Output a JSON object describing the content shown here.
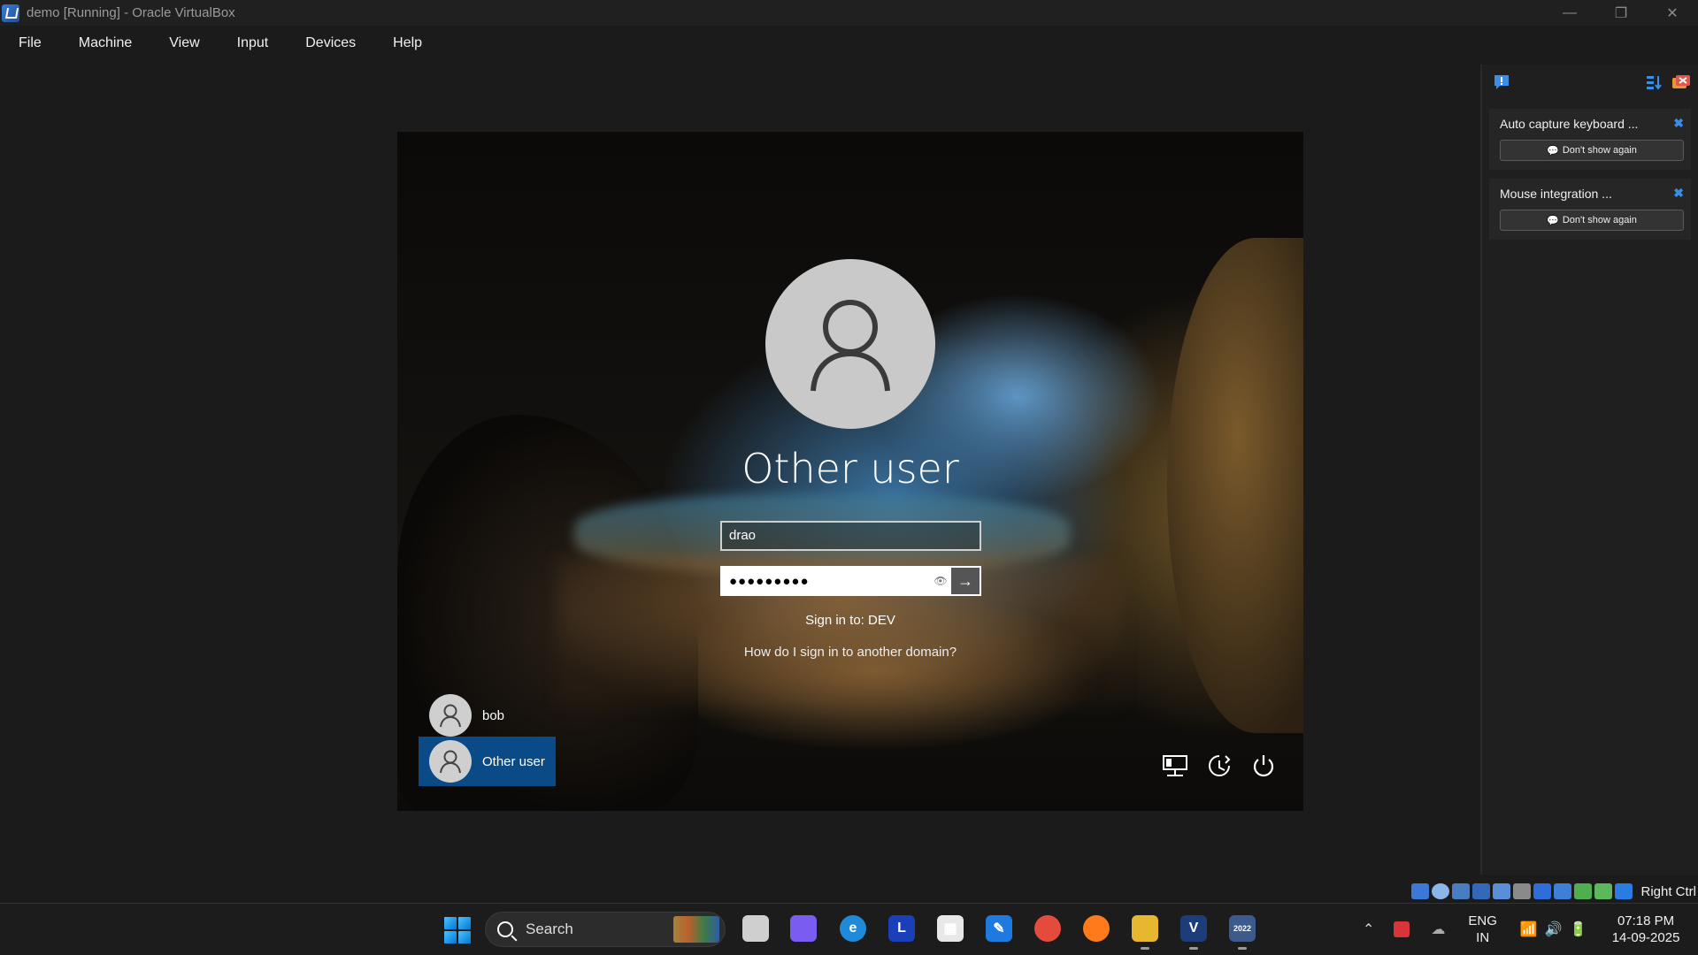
{
  "window": {
    "title": "demo [Running] - Oracle VirtualBox",
    "controls": {
      "minimize": "—",
      "restore": "❐",
      "close": "✕"
    }
  },
  "menu": [
    "File",
    "Machine",
    "View",
    "Input",
    "Devices",
    "Help"
  ],
  "login": {
    "user_title": "Other user",
    "username_value": "drao",
    "password_value": "●●●●●●●●●",
    "eye_glyph": "👁",
    "submit_glyph": "→",
    "sign_in_to": "Sign in to: DEV",
    "other_domain_link": "How do I sign in to another domain?",
    "users": [
      {
        "label": "bob",
        "selected": false
      },
      {
        "label": "Other user",
        "selected": true
      }
    ]
  },
  "notifications": [
    {
      "message": "Auto capture keyboard ...",
      "dont_show": "Don't show again"
    },
    {
      "message": "Mouse integration ...",
      "dont_show": "Don't show again"
    }
  ],
  "vbox_status": {
    "host_key": "Right Ctrl"
  },
  "taskbar": {
    "search_placeholder": "Search",
    "apps": [
      {
        "name": "task-view",
        "glyph": "",
        "color": "#cfcfcf"
      },
      {
        "name": "copilot",
        "glyph": "",
        "color": "#7b5cf0"
      },
      {
        "name": "edge",
        "glyph": "e",
        "color": "#1f8ad8"
      },
      {
        "name": "l-app",
        "glyph": "L",
        "color": "#1a3fb8"
      },
      {
        "name": "store",
        "glyph": "▦",
        "color": "#e8e8e8"
      },
      {
        "name": "pen-app",
        "glyph": "✎",
        "color": "#1f7adf"
      },
      {
        "name": "chrome",
        "glyph": "",
        "color": "#e54b3c"
      },
      {
        "name": "firefox",
        "glyph": "",
        "color": "#ff7a1a"
      },
      {
        "name": "file-explorer",
        "glyph": "",
        "color": "#e8b730"
      },
      {
        "name": "virtualbox",
        "glyph": "V",
        "color": "#1c3d7a"
      },
      {
        "name": "vm-2022",
        "glyph": "2022",
        "color": "#3c5a8c"
      }
    ],
    "language": "ENG",
    "region": "IN",
    "time": "07:18 PM",
    "date": "14-09-2025"
  }
}
